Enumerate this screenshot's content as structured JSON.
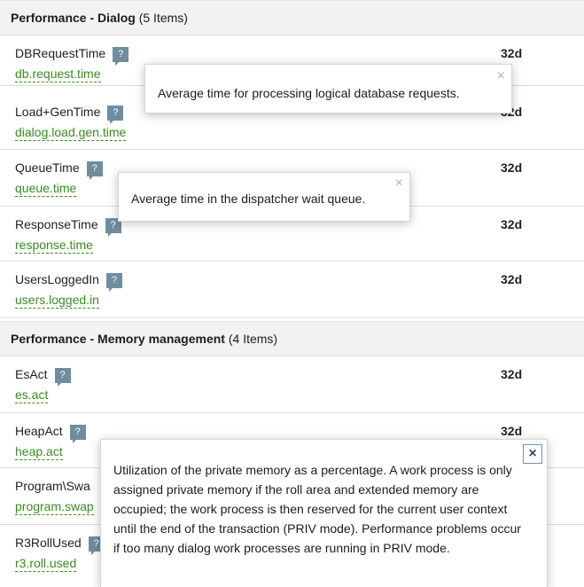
{
  "sections": [
    {
      "title": "Performance - Dialog",
      "count": "(5 Items)"
    },
    {
      "title": "Performance - Memory management",
      "count": "(4 Items)"
    }
  ],
  "rows": [
    {
      "name": "DBRequestTime",
      "key": "db.request.time",
      "period": "32d"
    },
    {
      "name": "Load+GenTime",
      "key": "dialog.load.gen.time",
      "period": "32d"
    },
    {
      "name": "QueueTime",
      "key": "queue.time",
      "period": "32d"
    },
    {
      "name": "ResponseTime",
      "key": "response.time",
      "period": "32d"
    },
    {
      "name": "UsersLoggedIn",
      "key": "users.logged.in",
      "period": "32d"
    },
    {
      "name": "EsAct",
      "key": "es.act",
      "period": "32d"
    },
    {
      "name": "HeapAct",
      "key": "heap.act",
      "period": "32d"
    },
    {
      "name": "Program\\Swa",
      "key": "program.swap",
      "period": ""
    },
    {
      "name": "R3RollUsed",
      "key": "r3.roll.used",
      "period": ""
    }
  ],
  "help_glyph": "?",
  "tooltips": {
    "db_request": {
      "text": "Average time for processing logical database requests.",
      "close": "×"
    },
    "queue": {
      "text": "Average time in the dispatcher wait queue.",
      "close": "×"
    },
    "heap": {
      "text": "Utilization of the private memory as a percentage. A work process is only assigned private memory if the roll area and extended memory are occupied; the work process is then reserved for the current user context until the end of the transaction (PRIV mode). Performance problems occur if too many dialog work processes are running in PRIV mode.",
      "close": "×"
    }
  }
}
